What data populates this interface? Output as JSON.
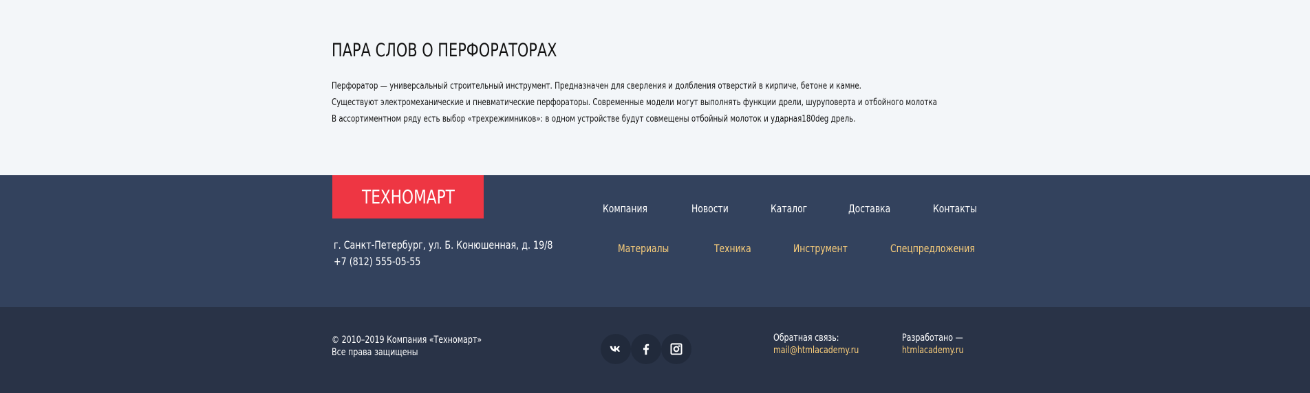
{
  "about": {
    "title": "ПАРА СЛОВ О ПЕРФОРАТОРАХ",
    "paragraphs": [
      "Перфоратор — универсальный строительный инструмент. Предназначен для сверления и долбления отверстий в кирпиче, бетоне и камне.",
      "Существуют электромеханические и пневматические перфораторы. Современные модели могут выполнять функции дрели, шуруповерта и отбойного молотка",
      "В ассортиментном ряду есть выбор «трехрежимников»: в одном устройстве будут совмещены отбойный молоток и ударная180deg дрель."
    ]
  },
  "footer": {
    "logo": "ТЕХНОМАРТ",
    "address": "г. Санкт-Петербург, ул. Б. Конюшенная, д. 19/8",
    "phone": "+7 (812) 555-05-55",
    "nav": [
      "Компания",
      "Новости",
      "Каталог",
      "Доставка",
      "Контакты"
    ],
    "catalog": [
      "Материалы",
      "Техника",
      "Инструмент",
      "Спецпредложения"
    ],
    "copyright": "© 2010–2019 Компания «Техномарт»",
    "rights": "Все права защищены",
    "social": [
      "vk-icon",
      "facebook-icon",
      "instagram-icon"
    ],
    "feedback_label": "Обратная связь:",
    "feedback_email": "mail@htmlacademy.ru",
    "developed_label": "Разработано —",
    "developed_link": "htmlacademy.ru"
  },
  "colors": {
    "accent_red": "#ee3643",
    "footer_top_bg": "#33425d",
    "footer_bottom_bg": "#293347",
    "link_yellow": "#fdd07b"
  }
}
